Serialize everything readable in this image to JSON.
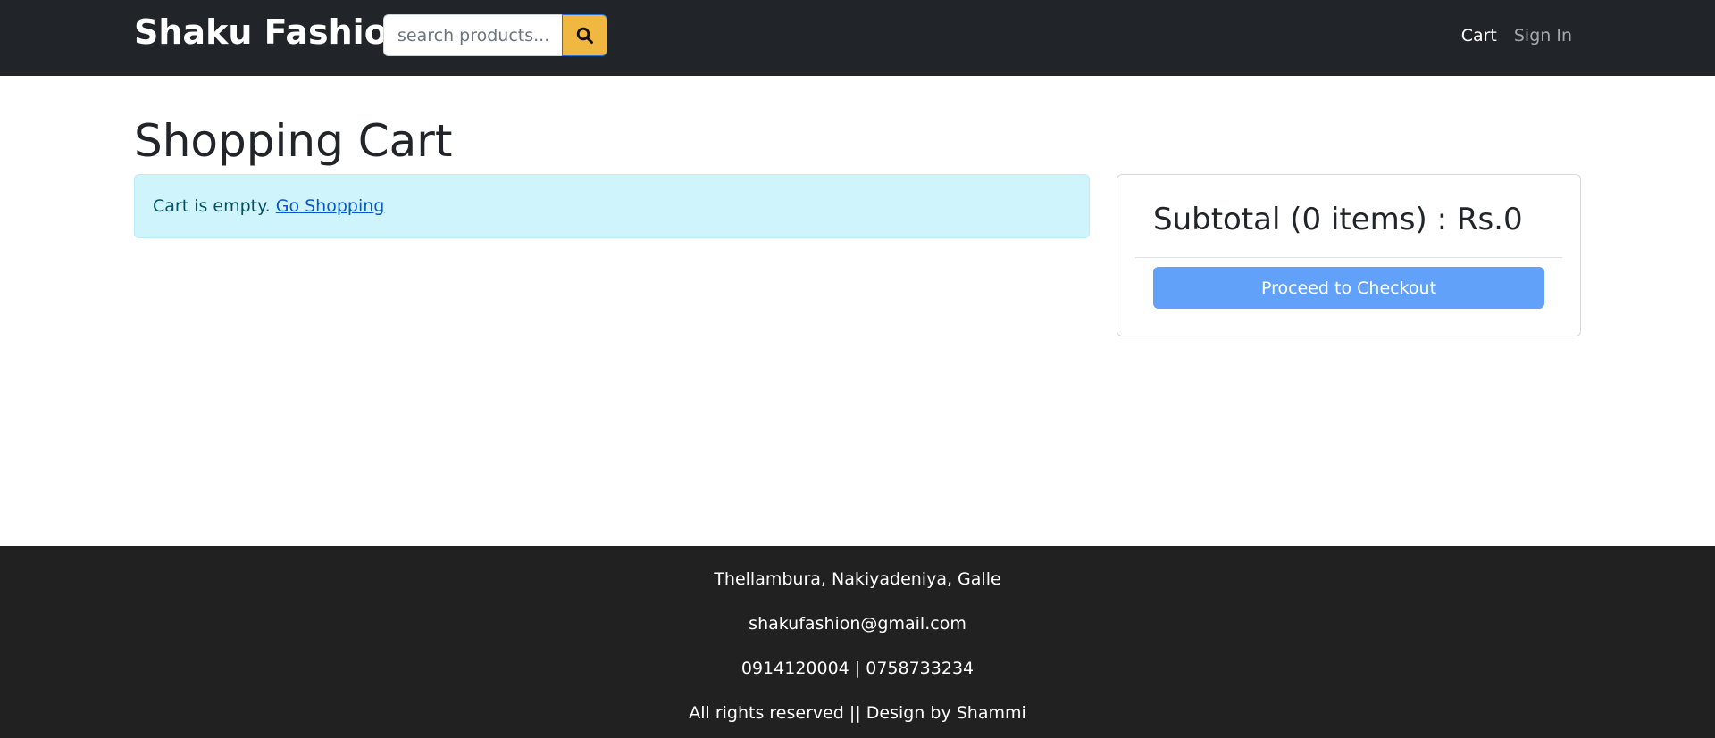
{
  "header": {
    "brand": "Shaku Fashion",
    "search": {
      "placeholder": "search products...",
      "value": "",
      "button_icon": "search-icon"
    },
    "nav": {
      "cart": "Cart",
      "sign_in": "Sign In"
    }
  },
  "main": {
    "title": "Shopping Cart",
    "alert": {
      "message": "Cart is empty.",
      "link": "Go Shopping"
    },
    "summary": {
      "subtotal": "Subtotal (0 items) : Rs.0",
      "checkout_label": "Proceed to Checkout"
    }
  },
  "footer": {
    "address": "Thellambura, Nakiyadeniya, Galle",
    "email": "shakufashion@gmail.com",
    "phone": "0914120004 | 0758733234",
    "copyright": "All rights reserved || Design by Shammi"
  },
  "colors": {
    "navbar_bg": "#212529",
    "search_button": "#f0b840",
    "alert_bg": "#cff4fc",
    "checkout_button": "#62a1f9",
    "footer_bg": "#212121"
  }
}
